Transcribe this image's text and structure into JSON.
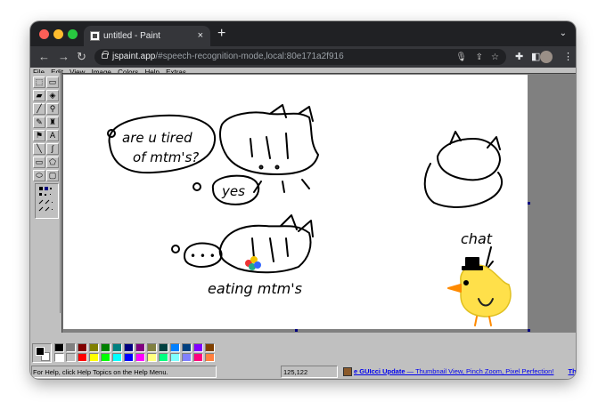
{
  "browser": {
    "tab_title": "untitled - Paint",
    "tab_close": "×",
    "new_tab": "+",
    "tab_list": "⌄",
    "url_host": "jspaint.app",
    "url_path": "/#speech-recognition-mode,local:80e171a2f916",
    "nav": {
      "back": "←",
      "forward": "→",
      "reload": "↻"
    },
    "toolbar_icons": [
      "mic-off-icon",
      "share-icon",
      "star-icon",
      "extensions-icon",
      "sidebar-icon",
      "profile-avatar",
      "menu-icon"
    ],
    "more": "⋮"
  },
  "menu": [
    "File",
    "Edit",
    "View",
    "Image",
    "Colors",
    "Help",
    "Extras"
  ],
  "tools": [
    {
      "name": "free-form-select-icon",
      "glyph": "⬚"
    },
    {
      "name": "select-icon",
      "glyph": "▭"
    },
    {
      "name": "eraser-icon",
      "glyph": "▰"
    },
    {
      "name": "fill-icon",
      "glyph": "◈"
    },
    {
      "name": "pick-color-icon",
      "glyph": "╱"
    },
    {
      "name": "magnifier-icon",
      "glyph": "⚲"
    },
    {
      "name": "pencil-icon",
      "glyph": "✎"
    },
    {
      "name": "brush-icon",
      "glyph": "♜"
    },
    {
      "name": "airbrush-icon",
      "glyph": "⚑"
    },
    {
      "name": "text-icon",
      "glyph": "A"
    },
    {
      "name": "line-icon",
      "glyph": "╲"
    },
    {
      "name": "curve-icon",
      "glyph": "∫"
    },
    {
      "name": "rectangle-icon",
      "glyph": "▭"
    },
    {
      "name": "polygon-icon",
      "glyph": "⬠"
    },
    {
      "name": "ellipse-icon",
      "glyph": "⬭"
    },
    {
      "name": "rounded-rectangle-icon",
      "glyph": "▢"
    }
  ],
  "drawing": {
    "bubble1": "are u tired of mtm's?",
    "reply1": "yes",
    "caption": "eating mtm's",
    "chat_label": "chat"
  },
  "palette": {
    "foreground": "#000000",
    "background": "#ffffff",
    "top_row": [
      "#000000",
      "#808080",
      "#800000",
      "#808000",
      "#008000",
      "#008080",
      "#000080",
      "#800080",
      "#808040",
      "#004040",
      "#0080ff",
      "#004080",
      "#8000ff",
      "#804000"
    ],
    "bottom_row": [
      "#ffffff",
      "#c0c0c0",
      "#ff0000",
      "#ffff00",
      "#00ff00",
      "#00ffff",
      "#0000ff",
      "#ff00ff",
      "#ffff80",
      "#00ff80",
      "#80ffff",
      "#8080ff",
      "#ff0080",
      "#ff8040"
    ]
  },
  "status": {
    "help_text": "For Help, click Help Topics on the Help Menu.",
    "position": "125,122",
    "news_title": "e GUIcci Update",
    "news_text": " — Thumbnail View, Pinch Zoom, Pixel Perfection!",
    "news_more": "Th"
  }
}
